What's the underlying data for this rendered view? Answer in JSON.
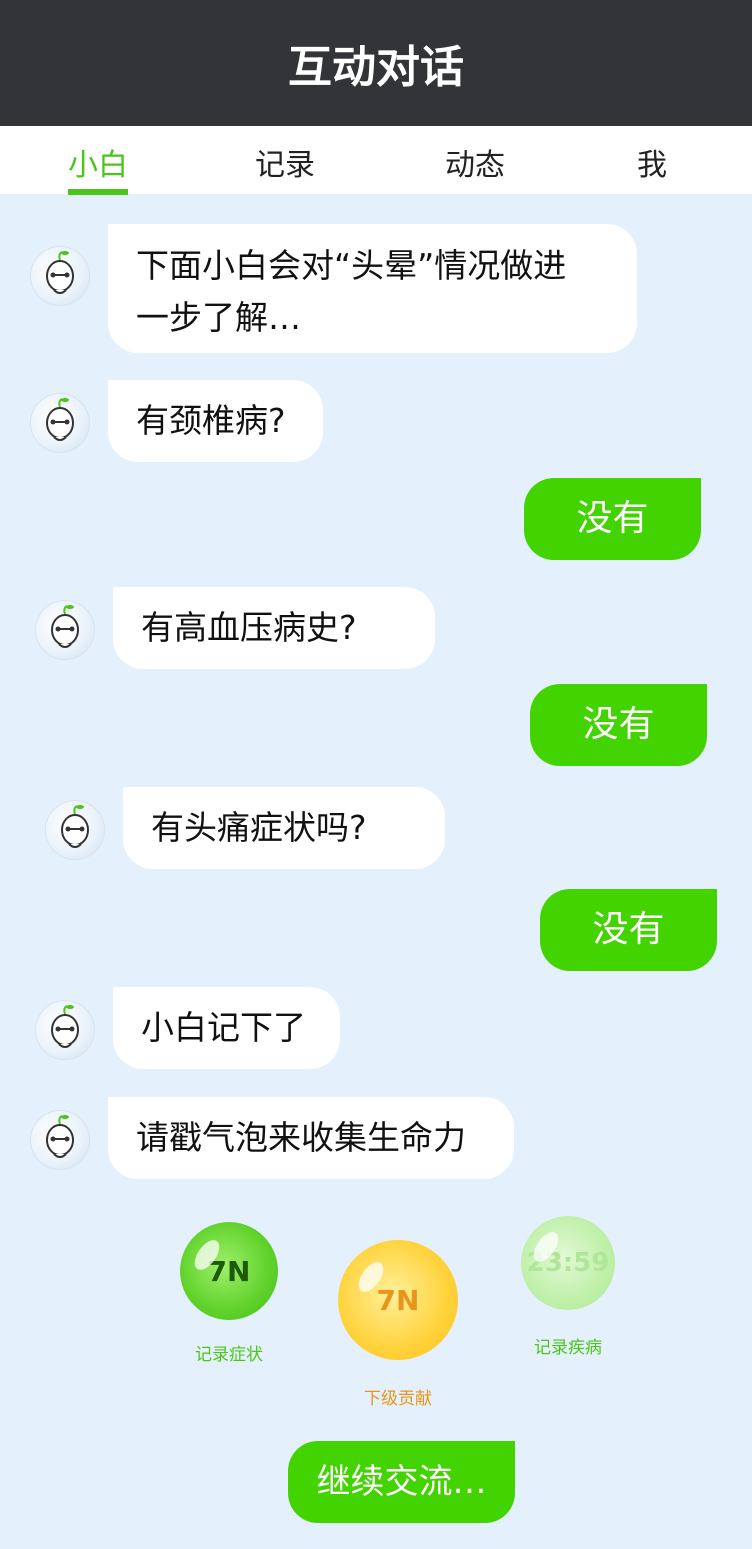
{
  "header": {
    "title": "互动对话"
  },
  "tabs": [
    {
      "label": "小白",
      "active": true
    },
    {
      "label": "记录",
      "active": false
    },
    {
      "label": "动态",
      "active": false
    },
    {
      "label": "我",
      "active": false
    }
  ],
  "messages": [
    {
      "from": "bot",
      "text_line1": "下面小白会对“头晕”情况做进",
      "text_line2": "一步了解…"
    },
    {
      "from": "bot",
      "text": "有颈椎病?"
    },
    {
      "from": "user",
      "text": "没有"
    },
    {
      "from": "bot",
      "text": "有高血压病史?"
    },
    {
      "from": "user",
      "text": "没有"
    },
    {
      "from": "bot",
      "text": "有头痛症状吗?"
    },
    {
      "from": "user",
      "text": "没有"
    },
    {
      "from": "bot",
      "text": "小白记下了"
    },
    {
      "from": "bot",
      "text": "请戳气泡来收集生命力"
    }
  ],
  "bubbles": [
    {
      "value": "7N",
      "label": "记录症状",
      "color": "#5fd12a"
    },
    {
      "value": "7N",
      "label": "下级贡献",
      "color": "#ffc928"
    },
    {
      "value": "23:59",
      "label": "记录疾病",
      "color": "#b6eca0"
    }
  ],
  "continue_button": {
    "label": "继续交流…"
  },
  "colors": {
    "accent": "#43d300",
    "header_bg": "#333438",
    "chat_bg": "#e4f1fc"
  }
}
